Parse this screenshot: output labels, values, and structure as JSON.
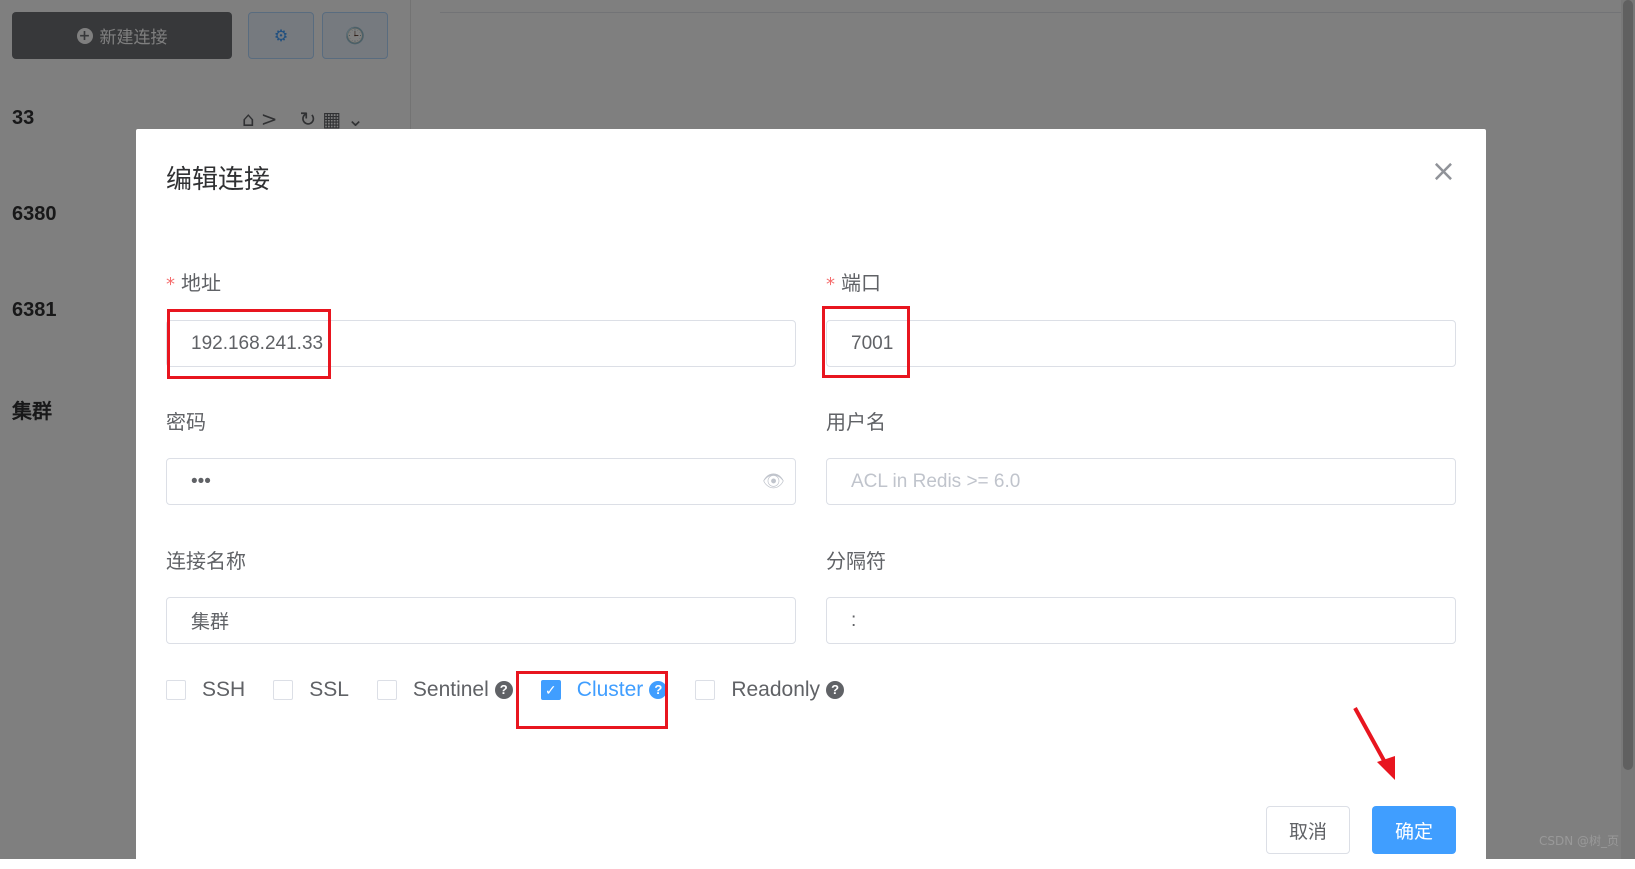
{
  "sidebar": {
    "new_connection": "新建连接",
    "connections": [
      "33",
      "6380",
      "6381",
      "集群"
    ]
  },
  "dialog": {
    "title": "编辑连接",
    "address": {
      "label": "地址",
      "value": "192.168.241.33"
    },
    "port": {
      "label": "端口",
      "value": "7001"
    },
    "password": {
      "label": "密码",
      "value": "•••"
    },
    "username": {
      "label": "用户名",
      "placeholder": "ACL in Redis >= 6.0"
    },
    "conn_name": {
      "label": "连接名称",
      "value": "集群"
    },
    "separator": {
      "label": "分隔符",
      "value": ":"
    },
    "options": [
      {
        "label": "SSH",
        "checked": false
      },
      {
        "label": "SSL",
        "checked": false
      },
      {
        "label": "Sentinel",
        "checked": false,
        "help": "?"
      },
      {
        "label": "Cluster",
        "checked": true,
        "help": "?"
      },
      {
        "label": "Readonly",
        "checked": false,
        "help": "?"
      }
    ],
    "cancel": "取消",
    "confirm": "确定"
  },
  "watermark": "CSDN @树_页",
  "colors": {
    "primary": "#409eff",
    "annotation": "#e8151f"
  }
}
